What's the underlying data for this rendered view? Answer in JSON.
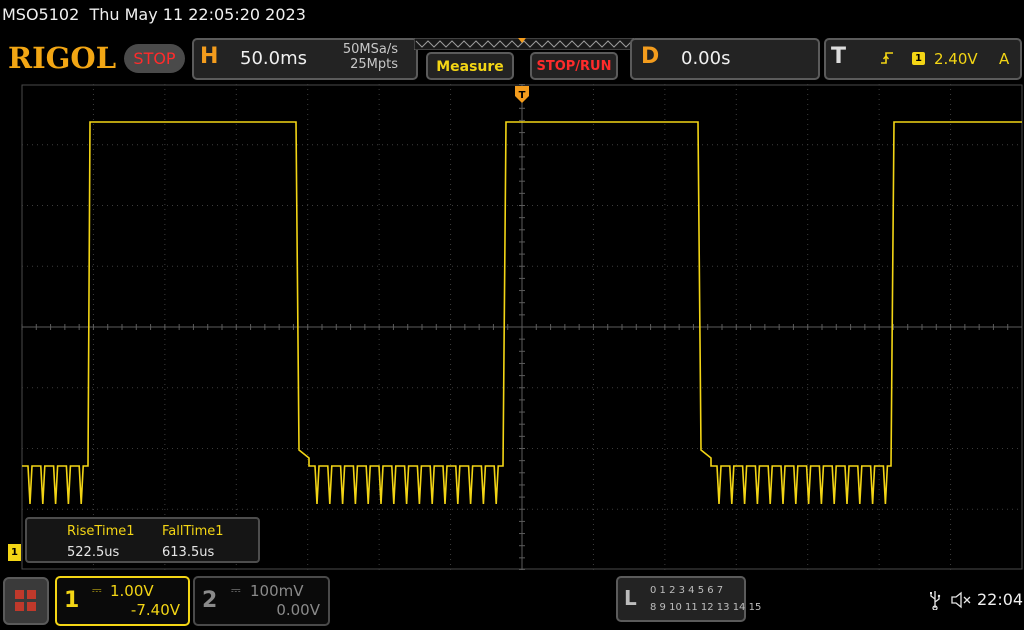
{
  "title_bar": {
    "model": "MSO5102",
    "datetime": "Thu May 11 22:05:20 2023"
  },
  "header": {
    "logo": "RIGOL",
    "run_state": "STOP",
    "horizontal": {
      "letter": "H",
      "timebase": "50.0ms",
      "sample_rate": "50MSa/s",
      "memory_depth": "25Mpts"
    },
    "measure_label": "Measure",
    "stoprun_label": "STOP/RUN",
    "delay": {
      "letter": "D",
      "value": "0.00s"
    },
    "trigger": {
      "letter": "T",
      "edge_icon": "rising-edge-icon",
      "source": "1",
      "level": "2.40V",
      "mode": "A"
    }
  },
  "waveform": {
    "color": "#f3d515",
    "trigger_marker": "T"
  },
  "measurements": [
    {
      "name": "RiseTime1",
      "value": "522.5us"
    },
    {
      "name": "FallTime1",
      "value": "613.5us"
    }
  ],
  "channels": [
    {
      "number": "1",
      "scale": "1.00V",
      "offset": "-7.40V",
      "active": true,
      "color": "#f3d515"
    },
    {
      "number": "2",
      "scale": "100mV",
      "offset": "0.00V",
      "active": false,
      "color": "#8a8a8a"
    }
  ],
  "ch1_ground_marker": "1",
  "logic": {
    "letter": "L",
    "row1": "0 1 2 3  4 5 6 7",
    "row2": "8 9 10 11 12 13 14 15"
  },
  "status": {
    "usb_icon": "usb-icon",
    "speaker_icon": "speaker-muted-icon",
    "clock": "22:04"
  }
}
